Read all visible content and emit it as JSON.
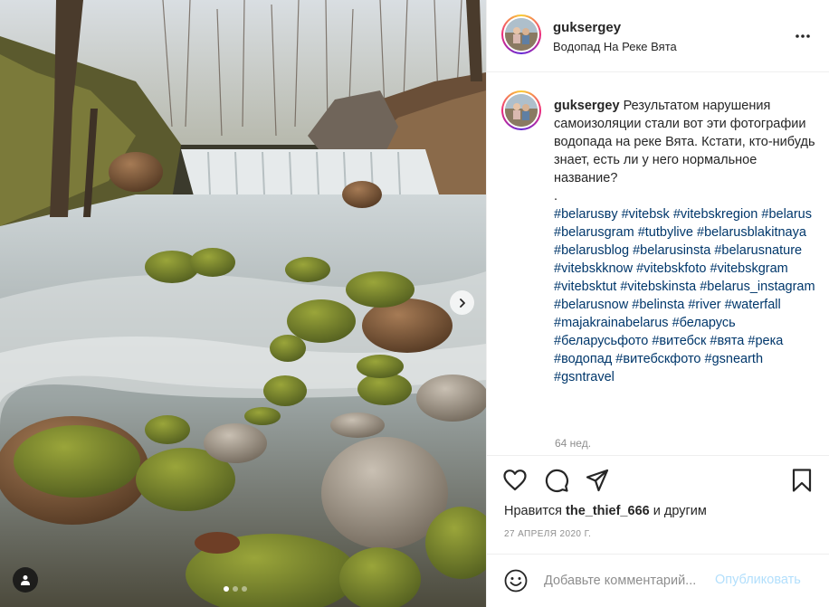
{
  "post": {
    "username": "guksergey",
    "location": "Водопад На Реке Вята",
    "caption_text": "Результатом нарушения самоизоляции стали вот эти фотографии водопада на реке Вята. Кстати, кто-нибудь знает, есть ли у него нормальное название?",
    "caption_dot": ".",
    "hashtags": [
      "#belarusвy",
      "#vitebsk",
      "#vitebskregion",
      "#belarus",
      "#belarusgram",
      "#tutbylive",
      "#belarusblakitnaya",
      "#belarusblog",
      "#belarusinsta",
      "#belarusnature",
      "#vitebskknow",
      "#vitebskfoto",
      "#vitebskgram",
      "#vitebsktut",
      "#vitebskinsta",
      "#belarus_instagram",
      "#belarusnow",
      "#belinsta",
      "#river",
      "#waterfall",
      "#majakrainabelarus",
      "#беларусь",
      "#беларусьфото",
      "#витебск",
      "#вята",
      "#река",
      "#водопад",
      "#витебскфото",
      "#gsnearth",
      "#gsntravel"
    ],
    "time_ago": "64 нед.",
    "likes_prefix": "Нравится",
    "liked_by": "the_thief_666",
    "likes_suffix": "и другим",
    "date": "27 АПРЕЛЯ 2020 Г."
  },
  "comment": {
    "placeholder": "Добавьте комментарий...",
    "publish_label": "Опубликовать"
  },
  "carousel": {
    "slide_count": 3,
    "active_index": 0
  },
  "icons": {
    "more": "more-horizontal-icon",
    "like": "heart-icon",
    "comment": "comment-bubble-icon",
    "share": "paper-plane-icon",
    "save": "bookmark-icon",
    "emoji": "smiley-icon",
    "next": "chevron-right-icon",
    "user_tag": "user-silhouette-icon"
  },
  "colors": {
    "hashtag": "#00376b",
    "publish_disabled": "#b2dffc",
    "muted": "#8e8e8e",
    "text": "#262626"
  }
}
